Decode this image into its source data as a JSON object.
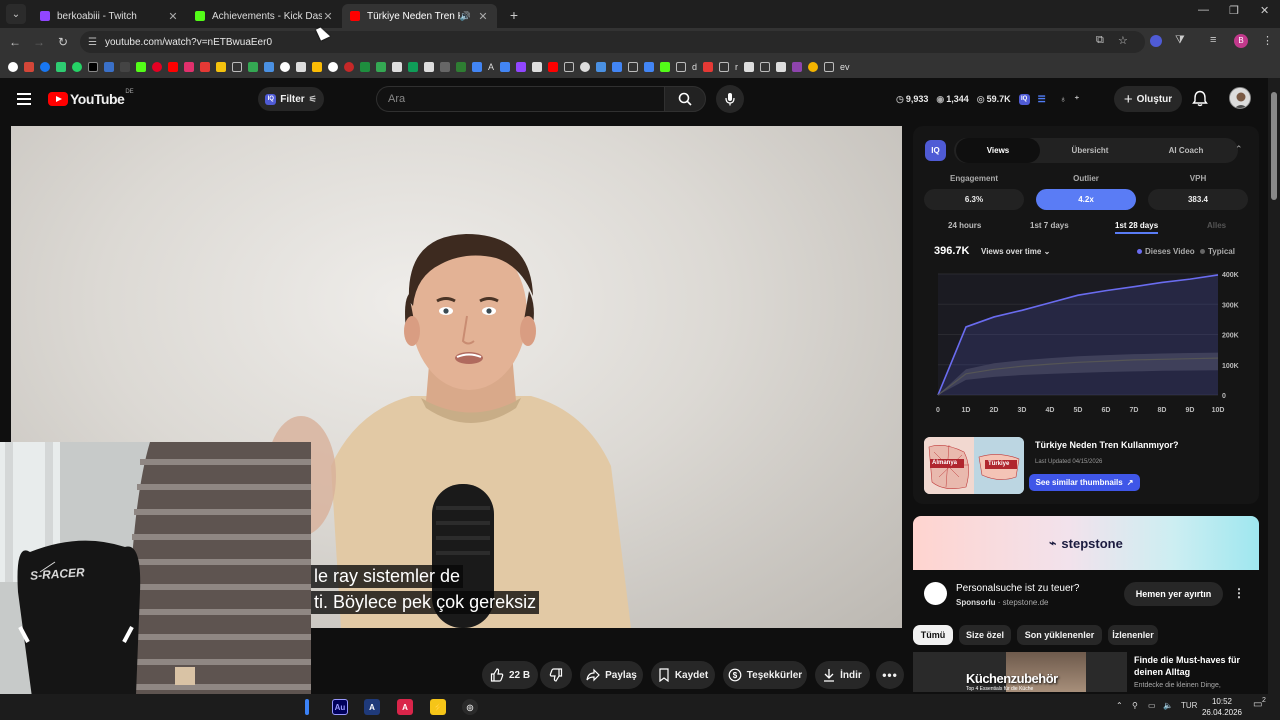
{
  "browser": {
    "tabs": [
      {
        "title": "berkoabiii - Twitch",
        "favicon_color": "#9146ff",
        "active": false
      },
      {
        "title": "Achievements - Kick Dashboard",
        "favicon_color": "#53fc18",
        "active": false
      },
      {
        "title": "Türkiye Neden Tren Kullanm",
        "favicon_color": "#ff0000",
        "active": true
      }
    ],
    "url": "youtube.com/watch?v=nETBwuaEer0"
  },
  "bookmarks": {
    "labels": [
      "A",
      "d",
      "r",
      "ev"
    ]
  },
  "youtube": {
    "logo_text": "YouTube",
    "country_code": "DE",
    "filter_label": "Filter",
    "search_placeholder": "Ara",
    "header_stats": {
      "clock_stat": "9,933",
      "eye_stat": "1,344",
      "views_stat": "59.7K"
    },
    "create_label": "Oluştur"
  },
  "video": {
    "subtitle_line1": "le ray sistemler de",
    "subtitle_line2": "ti. Böylece pek çok gereksiz"
  },
  "actions": {
    "like_count": "22 B",
    "share_label": "Paylaş",
    "save_label": "Kaydet",
    "thanks_label": "Teşekkürler",
    "download_label": "İndir"
  },
  "vidiq": {
    "logo_text": "IQ",
    "tabs": [
      "Views",
      "Übersicht",
      "AI Coach"
    ],
    "metrics": [
      {
        "label": "Engagement",
        "value": "6.3%"
      },
      {
        "label": "Outlier",
        "value": "4.2x"
      },
      {
        "label": "VPH",
        "value": "383.4"
      }
    ],
    "periods": [
      "24 hours",
      "1st 7 days",
      "1st 28 days",
      "Alles"
    ],
    "views_total": "396.7K",
    "views_dropdown": "Views over time",
    "legend_this": "Dieses Video",
    "legend_typical": "Typical",
    "thumb_title": "Türkiye Neden Tren Kullanmıyor?",
    "thumb_updated": "Last Updated 04/15/2026",
    "similar_btn": "See similar thumbnails",
    "thumb_labels": [
      "Almanya",
      "Türkiye"
    ]
  },
  "chart_data": {
    "type": "line",
    "x": [
      "0",
      "1D",
      "2D",
      "3D",
      "4D",
      "5D",
      "6D",
      "7D",
      "8D",
      "9D",
      "10D"
    ],
    "y_ticks": [
      "0",
      "100K",
      "200K",
      "300K",
      "400K"
    ],
    "ylim": [
      0,
      400000
    ],
    "series": [
      {
        "name": "Dieses Video",
        "values": [
          0,
          225000,
          258000,
          280000,
          305000,
          330000,
          345000,
          358000,
          372000,
          383000,
          397000
        ],
        "color": "#6a6cf0"
      },
      {
        "name": "Typical",
        "values": [
          0,
          70000,
          85000,
          95000,
          102000,
          108000,
          112000,
          116000,
          118000,
          120000,
          122000
        ],
        "color": "#555555"
      }
    ],
    "typical_band": {
      "upper": [
        0,
        85000,
        105000,
        115000,
        122000,
        128000,
        132000,
        135000,
        137000,
        139000,
        140000
      ],
      "lower": [
        0,
        50000,
        60000,
        66000,
        70000,
        73000,
        76000,
        78000,
        80000,
        81000,
        82000
      ]
    }
  },
  "ad": {
    "brand": "stepstone",
    "title": "Personalsuche ist zu teuer?",
    "sponsored": "Sponsorlu",
    "domain": "stepstone.de",
    "cta": "Hemen yer ayırtın"
  },
  "chips": [
    "Tümü",
    "Size özel",
    "Son yüklenenler",
    "İzlenenler"
  ],
  "recommendation": {
    "thumb_text": "Küchenzubehör",
    "thumb_small": "Top 4 Essentials für die Küche",
    "title": "Finde die Must-haves für deinen Alltag",
    "subtitle": "Entdecke die kleinen Dinge,"
  },
  "webcam": {
    "chair_brand": "S-RACER"
  },
  "taskbar": {
    "lang": "TUR",
    "time": "10:52",
    "date": "26.04.2026",
    "notif_count": "2"
  }
}
